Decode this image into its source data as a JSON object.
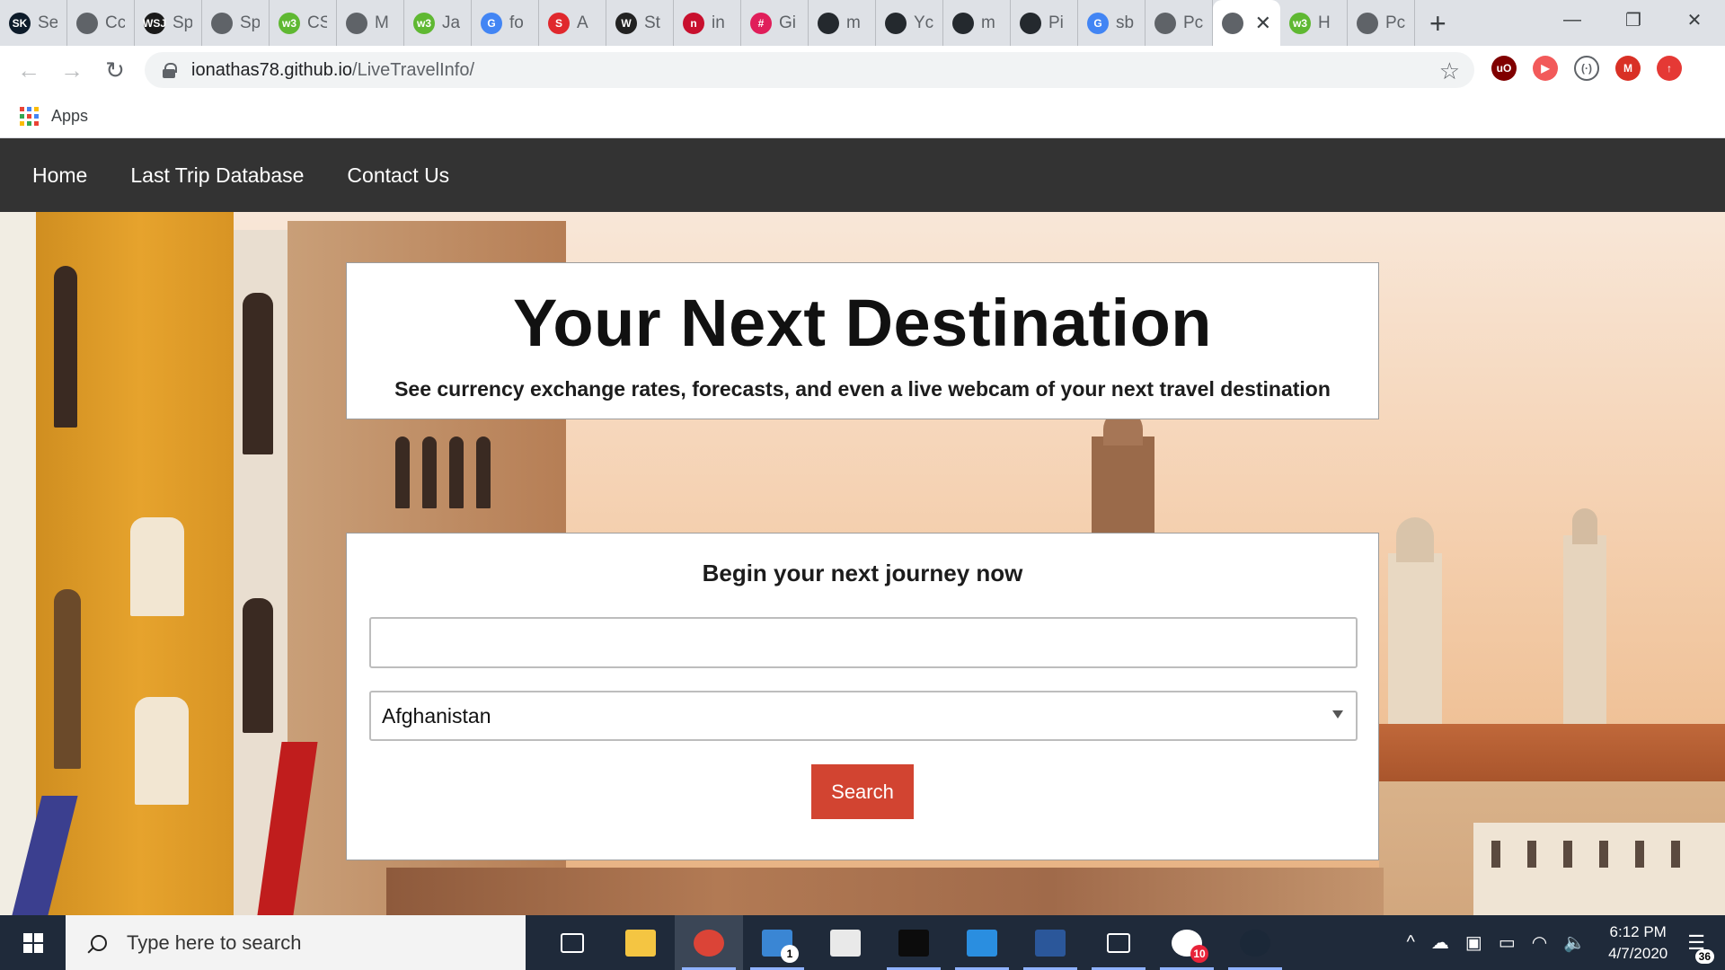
{
  "browser": {
    "tabs": [
      {
        "short": "Se",
        "fav_color": "#0d1b2a",
        "fav_text": "SK",
        "icon": "stack-icon"
      },
      {
        "short": "Cc",
        "fav_color": "#5f6368",
        "fav_text": "",
        "icon": "globe-icon"
      },
      {
        "short": "Sp",
        "fav_color": "#1a1a1a",
        "fav_text": "WSJ",
        "icon": "wsj-icon"
      },
      {
        "short": "Sp",
        "fav_color": "#5f6368",
        "fav_text": "",
        "icon": "globe-icon"
      },
      {
        "short": "CS",
        "fav_color": "#5fb832",
        "fav_text": "w3",
        "icon": "w3schools-icon"
      },
      {
        "short": "M",
        "fav_color": "#5f6368",
        "fav_text": "",
        "icon": "globe-icon"
      },
      {
        "short": "Ja",
        "fav_color": "#5fb832",
        "fav_text": "w3",
        "icon": "w3schools-icon"
      },
      {
        "short": "fo",
        "fav_color": "#4285f4",
        "fav_text": "G",
        "icon": "google-icon"
      },
      {
        "short": "A",
        "fav_color": "#e0282d",
        "fav_text": "S",
        "icon": "adobe-icon"
      },
      {
        "short": "St",
        "fav_color": "#222222",
        "fav_text": "W",
        "icon": "wikipedia-icon"
      },
      {
        "short": "in",
        "fav_color": "#c8102e",
        "fav_text": "n",
        "icon": "news-icon"
      },
      {
        "short": "Gi",
        "fav_color": "#e01e5a",
        "fav_text": "#",
        "icon": "slack-icon"
      },
      {
        "short": "m",
        "fav_color": "#24292e",
        "fav_text": "",
        "icon": "github-icon"
      },
      {
        "short": "Yc",
        "fav_color": "#24292e",
        "fav_text": "",
        "icon": "github-icon"
      },
      {
        "short": "m",
        "fav_color": "#24292e",
        "fav_text": "",
        "icon": "github-icon"
      },
      {
        "short": "Pi",
        "fav_color": "#24292e",
        "fav_text": "",
        "icon": "github-icon"
      },
      {
        "short": "sb",
        "fav_color": "#4285f4",
        "fav_text": "G",
        "icon": "google-icon"
      },
      {
        "short": "Pc",
        "fav_color": "#5f6368",
        "fav_text": "",
        "icon": "globe-icon"
      }
    ],
    "active_tab_close": "✕",
    "after_tabs": [
      {
        "short": "H",
        "fav_color": "#5fb832",
        "fav_text": "w3",
        "icon": "w3schools-icon"
      },
      {
        "short": "Pc",
        "fav_color": "#5f6368",
        "fav_text": "",
        "icon": "globe-icon"
      }
    ],
    "new_tab": "+",
    "window_controls": {
      "minimize": "—",
      "restore": "❐",
      "close": "✕"
    },
    "url_host": "ionathas78.github.io",
    "url_path": "/LiveTravelInfo/",
    "extensions": [
      {
        "icon": "ublock-icon",
        "color": "#800000",
        "text": "uO"
      },
      {
        "icon": "cast-icon",
        "color": "#f25a5a",
        "text": "▶"
      },
      {
        "icon": "extension-icon",
        "color": "#ffffff",
        "text": "(·)"
      },
      {
        "icon": "profile-avatar-icon",
        "color": "#d93025",
        "text": "M"
      },
      {
        "icon": "update-icon",
        "color": "#e53935",
        "text": "↑"
      }
    ],
    "bookmarks_apps_label": "Apps"
  },
  "site": {
    "nav": [
      "Home",
      "Last Trip Database",
      "Contact Us"
    ],
    "title": "Your Next Destination",
    "subtitle": "See currency exchange rates, forecasts, and even a live webcam of your next travel destination",
    "search_heading": "Begin your next journey now",
    "search_input_value": "",
    "country_selected": "Afghanistan",
    "search_button": "Search"
  },
  "taskbar": {
    "search_placeholder": "Type here to search",
    "apps": [
      {
        "icon": "task-view-icon",
        "color": "#1f2a3a",
        "running": false
      },
      {
        "icon": "file-explorer-icon",
        "color": "#f4c542",
        "running": false
      },
      {
        "icon": "chrome-icon",
        "color": "#db4437",
        "running": true,
        "focused": true
      },
      {
        "icon": "mail-icon",
        "color": "#3a86d4",
        "running": true,
        "badge": "1"
      },
      {
        "icon": "paint-icon",
        "color": "#e9e9e9",
        "running": false
      },
      {
        "icon": "terminal-icon",
        "color": "#0c0c0c",
        "running": true
      },
      {
        "icon": "vscode-icon",
        "color": "#2a8ee0",
        "running": true
      },
      {
        "icon": "word-icon",
        "color": "#2b579a",
        "running": true
      },
      {
        "icon": "settings-icon",
        "color": "#1f2a3a",
        "running": true
      },
      {
        "icon": "slack-icon",
        "color": "#ffffff",
        "running": true,
        "badge": "10"
      },
      {
        "icon": "steam-icon",
        "color": "#1b2838",
        "running": true
      }
    ],
    "tray_icons": [
      "^",
      "☁",
      "▣",
      "▭",
      "◠",
      "🔈"
    ],
    "time": "6:12 PM",
    "date": "4/7/2020",
    "notifications_count": "36"
  }
}
